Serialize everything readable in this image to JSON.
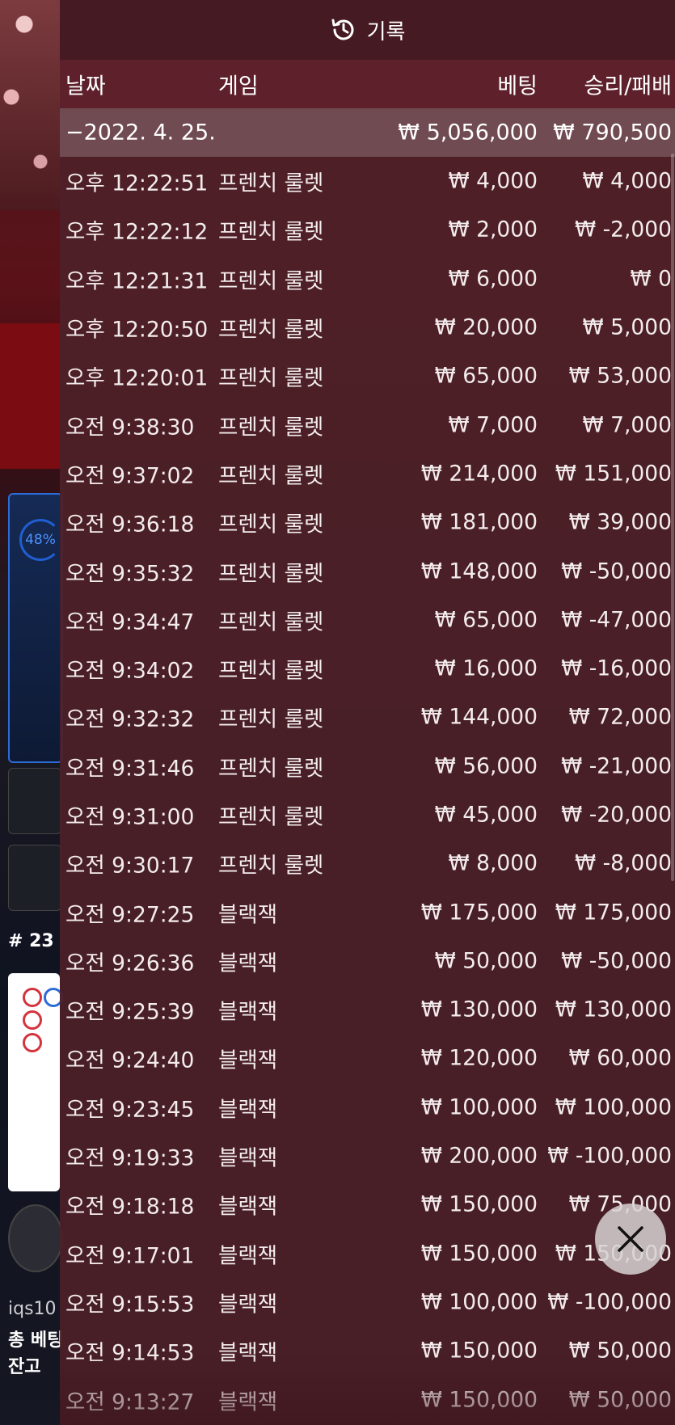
{
  "header": {
    "title": "기록",
    "icon": "history-icon"
  },
  "columns": {
    "date": "날짜",
    "game": "게임",
    "bet": "베팅",
    "win": "승리/패배"
  },
  "summary": {
    "date": "−2022. 4. 25.",
    "bet": "₩ 5,056,000",
    "win": "₩ 790,500"
  },
  "rows": [
    {
      "date": "오후 12:22:51",
      "game": "프렌치 룰렛",
      "bet": "₩ 4,000",
      "win": "₩ 4,000"
    },
    {
      "date": "오후 12:22:12",
      "game": "프렌치 룰렛",
      "bet": "₩ 2,000",
      "win": "₩ -2,000"
    },
    {
      "date": "오후 12:21:31",
      "game": "프렌치 룰렛",
      "bet": "₩ 6,000",
      "win": "₩ 0"
    },
    {
      "date": "오후 12:20:50",
      "game": "프렌치 룰렛",
      "bet": "₩ 20,000",
      "win": "₩ 5,000"
    },
    {
      "date": "오후 12:20:01",
      "game": "프렌치 룰렛",
      "bet": "₩ 65,000",
      "win": "₩ 53,000"
    },
    {
      "date": "오전 9:38:30",
      "game": "프렌치 룰렛",
      "bet": "₩ 7,000",
      "win": "₩ 7,000"
    },
    {
      "date": "오전 9:37:02",
      "game": "프렌치 룰렛",
      "bet": "₩ 214,000",
      "win": "₩ 151,000"
    },
    {
      "date": "오전 9:36:18",
      "game": "프렌치 룰렛",
      "bet": "₩ 181,000",
      "win": "₩ 39,000"
    },
    {
      "date": "오전 9:35:32",
      "game": "프렌치 룰렛",
      "bet": "₩ 148,000",
      "win": "₩ -50,000"
    },
    {
      "date": "오전 9:34:47",
      "game": "프렌치 룰렛",
      "bet": "₩ 65,000",
      "win": "₩ -47,000"
    },
    {
      "date": "오전 9:34:02",
      "game": "프렌치 룰렛",
      "bet": "₩ 16,000",
      "win": "₩ -16,000"
    },
    {
      "date": "오전 9:32:32",
      "game": "프렌치 룰렛",
      "bet": "₩ 144,000",
      "win": "₩ 72,000"
    },
    {
      "date": "오전 9:31:46",
      "game": "프렌치 룰렛",
      "bet": "₩ 56,000",
      "win": "₩ -21,000"
    },
    {
      "date": "오전 9:31:00",
      "game": "프렌치 룰렛",
      "bet": "₩ 45,000",
      "win": "₩ -20,000"
    },
    {
      "date": "오전 9:30:17",
      "game": "프렌치 룰렛",
      "bet": "₩ 8,000",
      "win": "₩ -8,000"
    },
    {
      "date": "오전 9:27:25",
      "game": "블랙잭",
      "bet": "₩ 175,000",
      "win": "₩ 175,000"
    },
    {
      "date": "오전 9:26:36",
      "game": "블랙잭",
      "bet": "₩ 50,000",
      "win": "₩ -50,000"
    },
    {
      "date": "오전 9:25:39",
      "game": "블랙잭",
      "bet": "₩ 130,000",
      "win": "₩ 130,000"
    },
    {
      "date": "오전 9:24:40",
      "game": "블랙잭",
      "bet": "₩ 120,000",
      "win": "₩ 60,000"
    },
    {
      "date": "오전 9:23:45",
      "game": "블랙잭",
      "bet": "₩ 100,000",
      "win": "₩ 100,000"
    },
    {
      "date": "오전 9:19:33",
      "game": "블랙잭",
      "bet": "₩ 200,000",
      "win": "₩ -100,000"
    },
    {
      "date": "오전 9:18:18",
      "game": "블랙잭",
      "bet": "₩ 150,000",
      "win": "₩ 75,000"
    },
    {
      "date": "오전 9:17:01",
      "game": "블랙잭",
      "bet": "₩ 150,000",
      "win": "₩ 150,000"
    },
    {
      "date": "오전 9:15:53",
      "game": "블랙잭",
      "bet": "₩ 100,000",
      "win": "₩ -100,000"
    },
    {
      "date": "오전 9:14:53",
      "game": "블랙잭",
      "bet": "₩ 150,000",
      "win": "₩ 50,000"
    },
    {
      "date": "오전 9:13:27",
      "game": "블랙잭",
      "bet": "₩ 150,000",
      "win": "₩ 50,000"
    }
  ],
  "background": {
    "percent": "48%",
    "round": "# 23",
    "user": "iqs10",
    "total_bet": "총 베팅",
    "balance": "잔고"
  },
  "close": {
    "icon": "close-icon"
  }
}
